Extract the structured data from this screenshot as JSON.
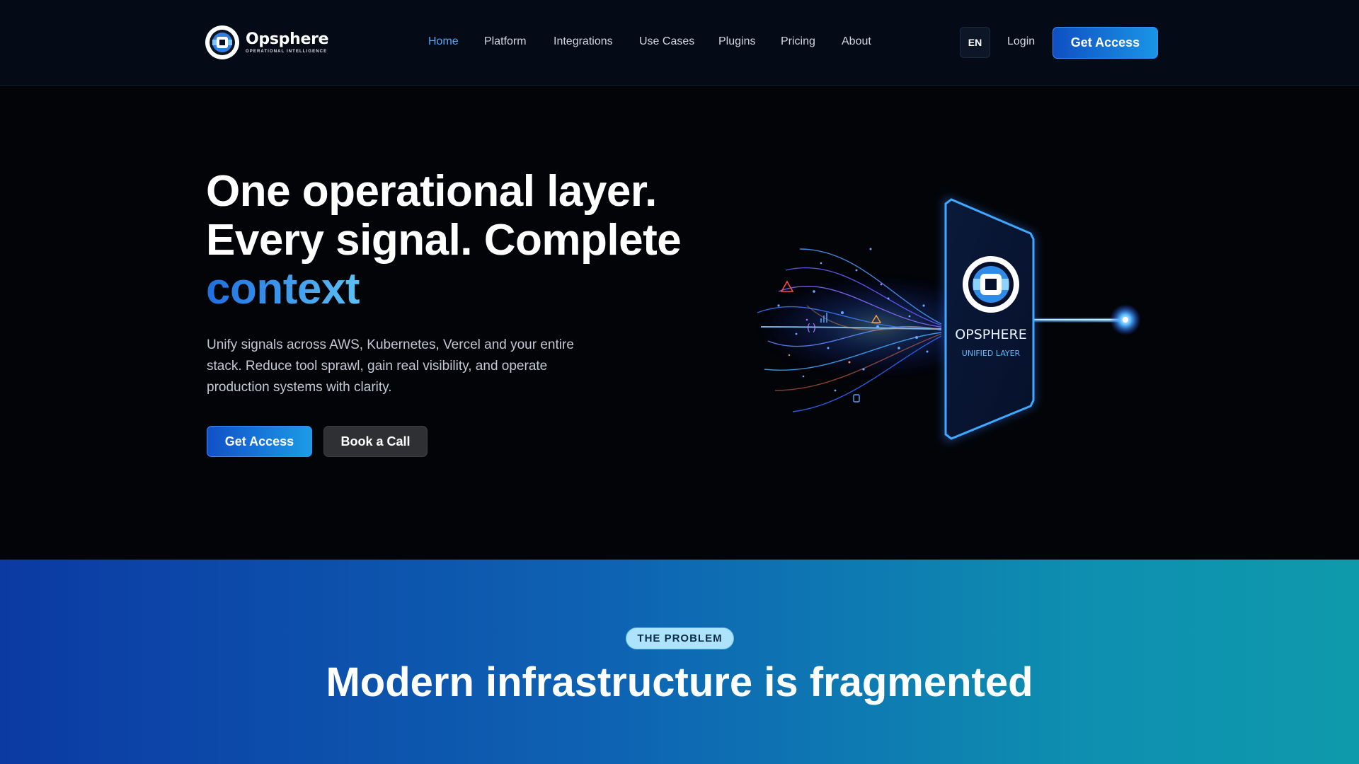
{
  "brand": {
    "name": "Opsphere",
    "tagline": "OPERATIONAL INTELLIGENCE",
    "colors": {
      "accent": "#1c8fe6",
      "active_nav": "#4ea8f5",
      "background": "#030407"
    }
  },
  "nav": {
    "items": [
      {
        "label": "Home",
        "active": true
      },
      {
        "label": "Platform",
        "active": false
      },
      {
        "label": "Integrations",
        "active": false
      },
      {
        "label": "Use Cases",
        "active": false
      },
      {
        "label": "Plugins",
        "active": false
      },
      {
        "label": "Pricing",
        "active": false
      },
      {
        "label": "About",
        "active": false
      }
    ]
  },
  "header": {
    "language": "EN",
    "login_label": "Login",
    "cta_label": "Get Access"
  },
  "hero": {
    "title_line1": "One operational layer.",
    "title_line2": "Every signal. Complete",
    "title_accent": "context",
    "subtitle": "Unify signals across AWS, Kubernetes, Vercel and your entire stack. Reduce tool sprawl, gain real visibility, and operate production systems with clarity.",
    "primary_cta": "Get Access",
    "secondary_cta": "Book a Call",
    "art": {
      "device_name": "OPSPHERE",
      "device_label": "UNIFIED LAYER"
    }
  },
  "problem": {
    "badge": "THE PROBLEM",
    "title": "Modern infrastructure is fragmented"
  }
}
